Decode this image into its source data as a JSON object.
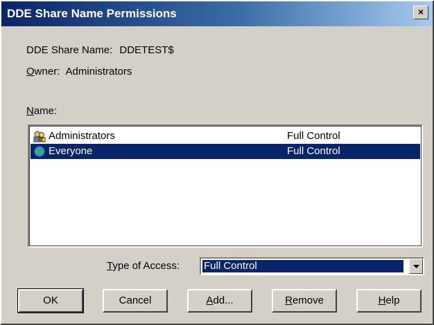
{
  "window": {
    "title": "DDE Share Name Permissions",
    "close_label": "×"
  },
  "share": {
    "label": "DDE Share Name:",
    "value": "DDETEST$"
  },
  "owner": {
    "accel": "O",
    "label_rest": "wner:",
    "value": "Administrators"
  },
  "name_section": {
    "accel": "N",
    "label_rest": "ame:"
  },
  "permissions": [
    {
      "name": "Administrators",
      "access": "Full Control",
      "icon": "group-icon",
      "selected": false
    },
    {
      "name": "Everyone",
      "access": "Full Control",
      "icon": "globe-icon",
      "selected": true
    }
  ],
  "type_of_access": {
    "accel": "T",
    "label_rest": "ype of Access:",
    "value": "Full Control"
  },
  "buttons": {
    "ok": "OK",
    "cancel": "Cancel",
    "add_accel": "A",
    "add_rest": "dd...",
    "remove_accel": "R",
    "remove_rest": "emove",
    "help_accel": "H",
    "help_rest": "elp"
  },
  "colors": {
    "selection": "#0a246a",
    "face": "#d4d0c8",
    "title_start": "#0a246a",
    "title_end": "#a6caf0"
  }
}
